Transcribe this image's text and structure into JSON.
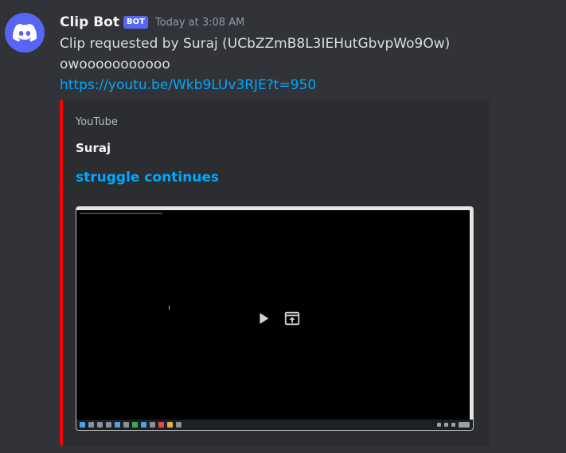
{
  "message": {
    "author": "Clip Bot",
    "badge": "BOT",
    "timestamp": "Today at 3:08 AM",
    "lines": [
      "Clip requested by Suraj (UCbZZmB8L3IEHutGbvpWo9Ow)",
      "owooooooooooo"
    ],
    "link": "https://youtu.be/Wkb9LUv3RJE?t=950"
  },
  "embed": {
    "provider": "YouTube",
    "author": "Suraj",
    "title": "struggle continues",
    "accent_color": "#ff0000"
  },
  "icons": {
    "avatar": "discord-logo-icon",
    "play": "play-icon",
    "open_external": "open-external-icon"
  }
}
